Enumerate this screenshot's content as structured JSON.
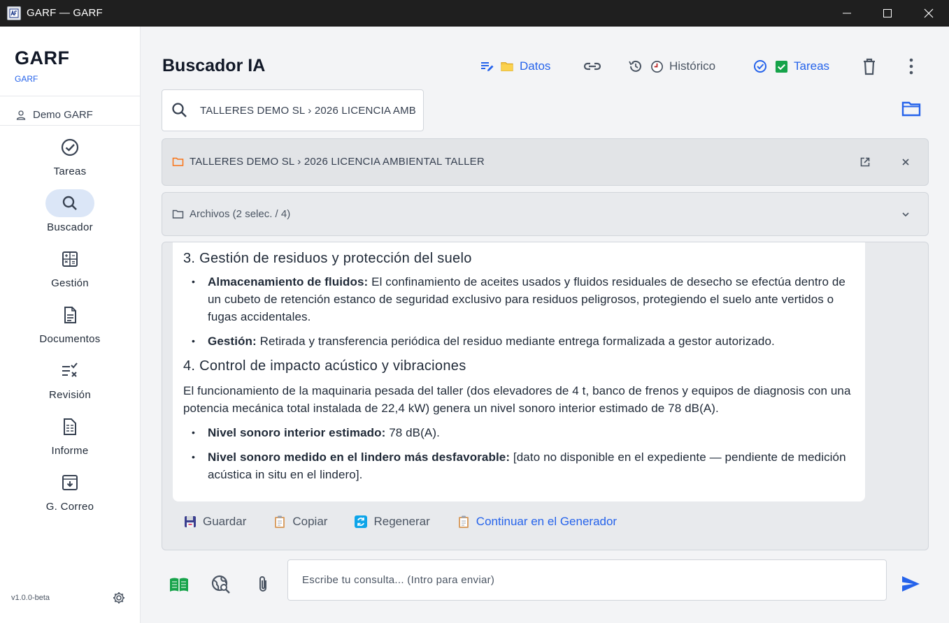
{
  "window": {
    "title": "GARF — GARF"
  },
  "sidebar": {
    "brand": "GARF",
    "brand_sub": "GARF",
    "user": "Demo GARF",
    "items": [
      {
        "label": "Tareas",
        "icon": "check-circle-icon",
        "active": false
      },
      {
        "label": "Buscador",
        "icon": "search-icon",
        "active": true
      },
      {
        "label": "Gestión",
        "icon": "calculator-icon",
        "active": false
      },
      {
        "label": "Documentos",
        "icon": "document-icon",
        "active": false
      },
      {
        "label": "Revisión",
        "icon": "list-check-icon",
        "active": false
      },
      {
        "label": "Informe",
        "icon": "report-icon",
        "active": false
      },
      {
        "label": "G. Correo",
        "icon": "archive-icon",
        "active": false
      }
    ],
    "version": "v1.0.0-beta"
  },
  "header": {
    "title": "Buscador IA",
    "datos": "Datos",
    "historico": "Histórico",
    "tareas": "Tareas"
  },
  "search": {
    "value": "TALLERES DEMO SL › 2026 LICENCIA AMB"
  },
  "context": {
    "path": "TALLERES DEMO SL › 2026 LICENCIA AMBIENTAL TALLER"
  },
  "files": {
    "label": "Archivos (2 selec. / 4)"
  },
  "answer": {
    "s3_title": "3. Gestión de residuos y protección del suelo",
    "s3_b1_label": "Almacenamiento de fluidos:",
    "s3_b1_text": " El confinamiento de aceites usados y fluidos residuales de desecho se efectúa dentro de un cubeto de retención estanco de seguridad exclusivo para residuos peligrosos, protegiendo el suelo ante vertidos o fugas accidentales.",
    "s3_b2_label": "Gestión:",
    "s3_b2_text": " Retirada y transferencia periódica del residuo mediante entrega formalizada a gestor autorizado.",
    "s4_title": "4. Control de impacto acústico y vibraciones",
    "s4_para": "El funcionamiento de la maquinaria pesada del taller (dos elevadores de 4 t, banco de frenos y equipos de diagnosis con una potencia mecánica total instalada de 22,4 kW) genera un nivel sonoro interior estimado de 78 dB(A).",
    "s4_b1_label": "Nivel sonoro interior estimado:",
    "s4_b1_text": " 78 dB(A).",
    "s4_b2_label": "Nivel sonoro medido en el lindero más desfavorable:",
    "s4_b2_text": " [dato no disponible en el expediente — pendiente de medición acústica in situ en el lindero]."
  },
  "actions": {
    "guardar": "Guardar",
    "copiar": "Copiar",
    "regenerar": "Regenerar",
    "continuar": "Continuar en el Generador"
  },
  "chat": {
    "placeholder": "Escribe tu consulta... (Intro para enviar)"
  },
  "colors": {
    "accent": "#2563eb",
    "green": "#16a34a",
    "sidebar_active": "#dbe6f7"
  }
}
